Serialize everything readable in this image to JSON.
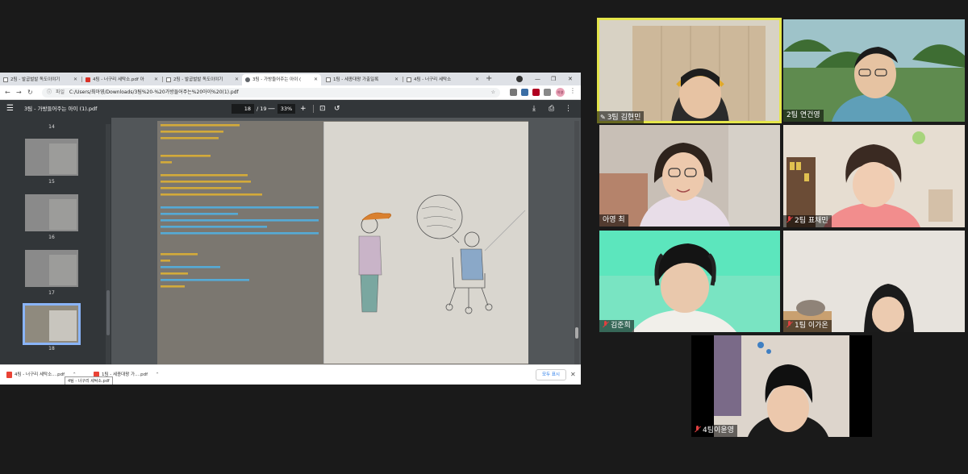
{
  "browser": {
    "tabs": [
      {
        "label": "2팀 - 발굽벌발 독도이야기",
        "icon": "doc-icon"
      },
      {
        "label": "4팀 - 너구리 세탁소.pdf 아",
        "icon": "gmail-icon"
      },
      {
        "label": "2팀 - 발굽벌발 독도이야기",
        "icon": "doc-icon"
      },
      {
        "label": "3팀 - 가방들어주는 아이 (",
        "icon": "globe-icon",
        "active": true
      },
      {
        "label": "1팀 - 세종대왕 가출일록",
        "icon": "doc-icon"
      },
      {
        "label": "4팀 - 너구리 세탁소",
        "icon": "doc-icon"
      }
    ],
    "address": {
      "label": "파일",
      "url": "C:/Users/최아영/Downloads/3팀%20-%20가방들어주는%20아이%20(1).pdf"
    },
    "profile_label": "아영"
  },
  "pdf": {
    "title": "3팀 - 가방들어주는 아이 (1).pdf",
    "current_page": "18",
    "total_pages": "/ 19",
    "zoom": "33%",
    "thumbnails": [
      {
        "num": "14"
      },
      {
        "num": "15"
      },
      {
        "num": "16"
      },
      {
        "num": "17"
      },
      {
        "num": "18",
        "selected": true
      }
    ]
  },
  "downloads": {
    "items": [
      {
        "label": "4팀 - 너구리 세탁소....pdf"
      },
      {
        "label": "1팀 - 세종대왕 가....pdf"
      }
    ],
    "tooltip": "4팀 - 너구리 세탁소.pdf",
    "show_all": "모두 표시"
  },
  "participants": [
    {
      "name": "3팀 김현민",
      "pinned": true,
      "speaking": true
    },
    {
      "name": "2팀 연건영"
    },
    {
      "name": "아영 최"
    },
    {
      "name": "2팀 표채민",
      "muted": true
    },
    {
      "name": "김준희",
      "muted": true
    },
    {
      "name": "1팀 이가온",
      "muted": true
    },
    {
      "name": "4팀이윤영",
      "muted": true
    }
  ]
}
